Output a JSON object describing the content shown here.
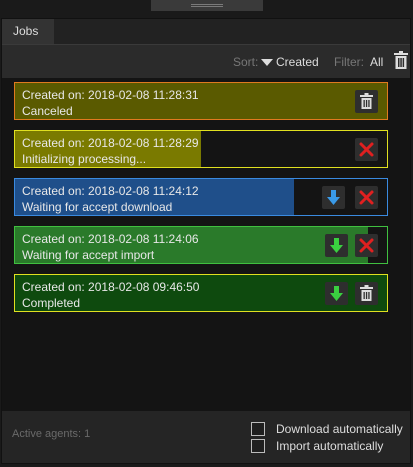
{
  "tabs": [
    {
      "label": "Jobs"
    }
  ],
  "toolbar": {
    "sort_label": "Sort:",
    "sort_value": "Created",
    "filter_label": "Filter:",
    "filter_value": "All",
    "delete_icon": "trash-icon"
  },
  "jobs": [
    {
      "created": "Created on: 2018-02-08 11:28:31",
      "status": "Canceled",
      "border_color": "#e07a20",
      "fill_color": "#5a5a00",
      "background": "#141414",
      "progress": 1.0,
      "actions": [
        "delete"
      ]
    },
    {
      "created": "Created on: 2018-02-08 11:28:29",
      "status": "Initializing processing...",
      "border_color": "#e0e020",
      "fill_color": "#7a7a00",
      "background": "#141414",
      "progress": 0.5,
      "actions": [
        "cancel"
      ]
    },
    {
      "created": "Created on: 2018-02-08 11:24:12",
      "status": "Waiting for accept download",
      "border_color": "#3a8ae0",
      "fill_color": "#1f4f8a",
      "background": "#141414",
      "progress": 0.75,
      "actions": [
        "download",
        "cancel"
      ]
    },
    {
      "created": "Created on: 2018-02-08 11:24:06",
      "status": "Waiting for accept import",
      "border_color": "#40c040",
      "fill_color": "#2a7a2a",
      "background": "#141414",
      "progress": 0.95,
      "actions": [
        "import",
        "cancel"
      ]
    },
    {
      "created": "Created on: 2018-02-08 09:46:50",
      "status": "Completed",
      "border_color": "#e0e020",
      "fill_color": "#0e4a0e",
      "background": "#141414",
      "progress": 1.0,
      "actions": [
        "import",
        "delete"
      ]
    }
  ],
  "footer": {
    "active_agents": "Active agents: 1",
    "download_auto_label": "Download automatically",
    "import_auto_label": "Import automatically",
    "download_auto_checked": false,
    "import_auto_checked": false
  }
}
